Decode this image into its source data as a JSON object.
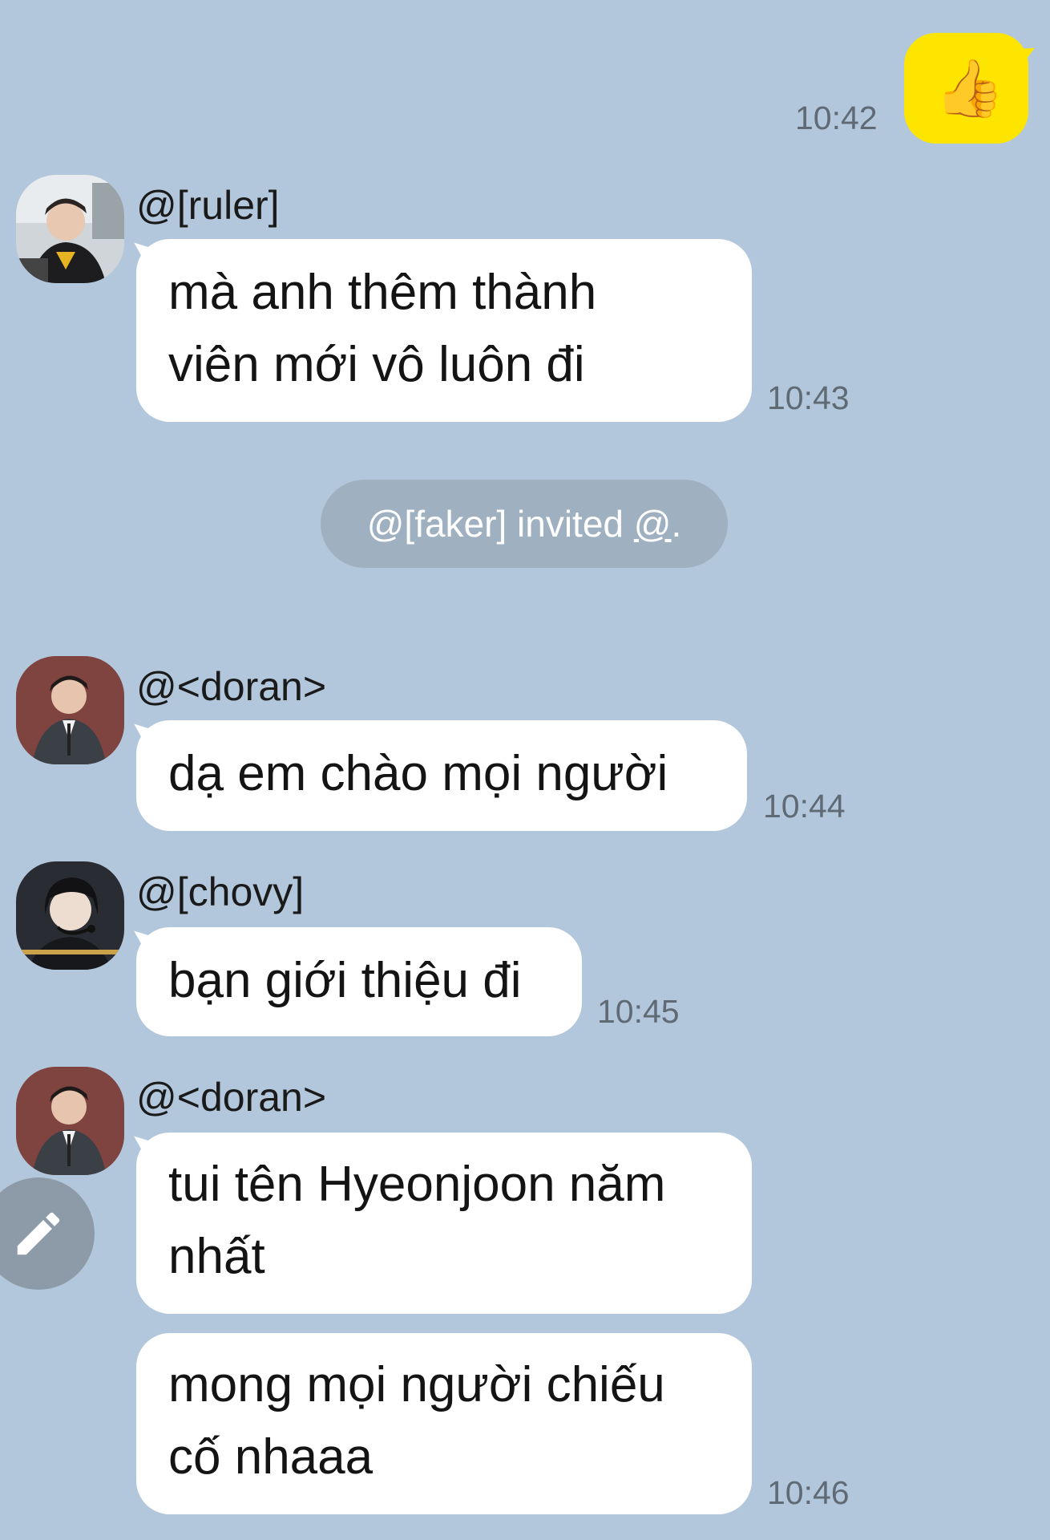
{
  "messages": {
    "out_1": {
      "emoji": "👍",
      "time": "10:42"
    },
    "ruler": {
      "sender": "@[ruler]",
      "text": "mà anh thêm thành\nviên mới vô luôn đi",
      "time": "10:43"
    },
    "system": {
      "prefix": "@[faker] invited ",
      "mention": "@",
      "suffix": "."
    },
    "doran_1": {
      "sender": "@<doran>",
      "text": "dạ em chào mọi người",
      "time": "10:44"
    },
    "chovy": {
      "sender": "@[chovy]",
      "text": "bạn giới thiệu đi",
      "time": "10:45"
    },
    "doran_2": {
      "sender": "@<doran>",
      "text_1": "tui tên Hyeonjoon năm\nnhất",
      "text_2": "mong mọi người chiếu\ncố nhaaa",
      "time": "10:46"
    }
  },
  "icons": {
    "compose": "pencil-icon",
    "reaction": "thumbs-up-emoji"
  },
  "colors": {
    "background": "#b3c7dc",
    "outgoing_bubble": "#fee500",
    "incoming_bubble": "#ffffff",
    "system_pill": "#9fb0c1",
    "timestamp": "#5f6a75"
  }
}
